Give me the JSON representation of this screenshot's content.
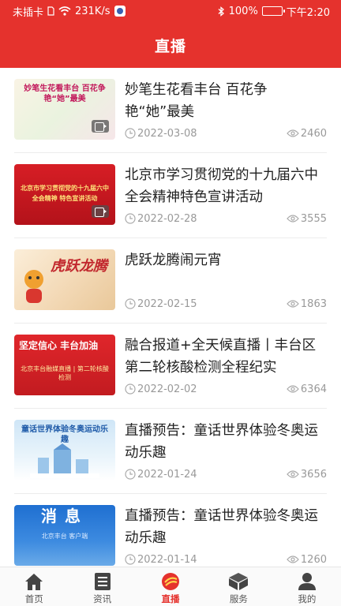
{
  "status_bar": {
    "carrier": "未插卡",
    "speed": "231K/s",
    "battery": "100%",
    "time": "下午2:20"
  },
  "header": {
    "title": "直播"
  },
  "items": [
    {
      "title": "妙笔生花看丰台 百花争艳“她”最美",
      "date": "2022-03-08",
      "views": "2460",
      "thumb_text": "妙笔生花看丰台 百花争艳“她”最美",
      "has_video": true
    },
    {
      "title": "北京市学习贯彻党的十九届六中全会精神特色宣讲活动",
      "date": "2022-02-28",
      "views": "3555",
      "thumb_text": "北京市学习贯彻党的十九届六中全会精神 特色宣讲活动",
      "has_video": true
    },
    {
      "title": "虎跃龙腾闹元宵",
      "date": "2022-02-15",
      "views": "1863",
      "thumb_text": "虎跃龙腾",
      "has_video": false
    },
    {
      "title": "融合报道+全天候直播丨丰台区第二轮核酸检测全程纪实",
      "date": "2022-02-02",
      "views": "6364",
      "thumb_text": "坚定信心 丰台加油",
      "thumb_sub": "北京丰台融媒直播 | 第二轮核酸检测",
      "has_video": false
    },
    {
      "title": "直播预告：童话世界体验冬奥运动乐趣",
      "date": "2022-01-24",
      "views": "3656",
      "thumb_text": "童话世界体验冬奥运动乐趣",
      "has_video": false
    },
    {
      "title": "直播预告：童话世界体验冬奥运动乐趣",
      "date": "2022-01-14",
      "views": "1260",
      "thumb_text": "消息",
      "thumb_sub": "北京丰台 客户端",
      "has_video": false
    }
  ],
  "tabs": [
    {
      "label": "首页",
      "icon": "home-icon",
      "active": false
    },
    {
      "label": "资讯",
      "icon": "news-icon",
      "active": false
    },
    {
      "label": "直播",
      "icon": "live-icon",
      "active": true
    },
    {
      "label": "服务",
      "icon": "box-icon",
      "active": false
    },
    {
      "label": "我的",
      "icon": "user-icon",
      "active": false
    }
  ],
  "colors": {
    "accent": "#e5322d",
    "muted": "#999999"
  }
}
